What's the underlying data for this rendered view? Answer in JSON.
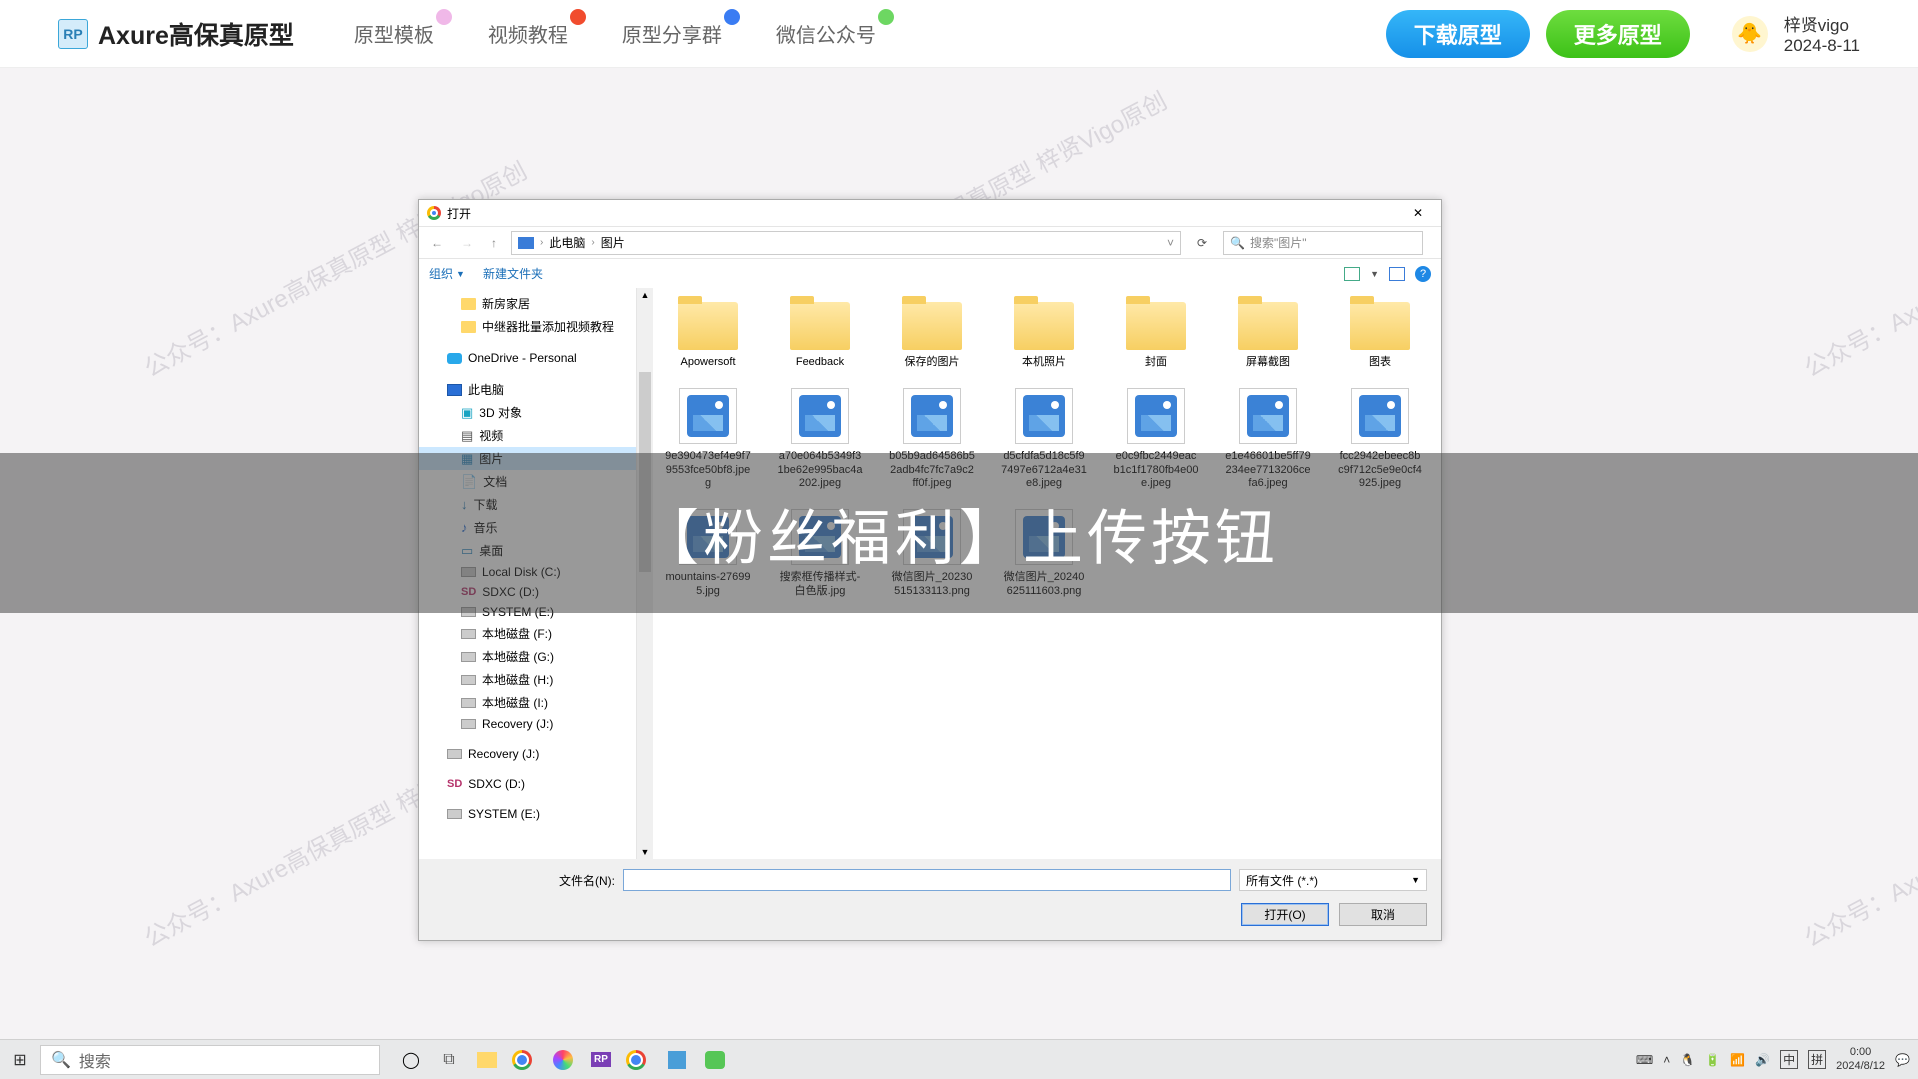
{
  "header": {
    "logo_badge": "RP",
    "logo_text": "Axure高保真原型",
    "nav": [
      "原型模板",
      "视频教程",
      "原型分享群",
      "微信公众号"
    ],
    "btn_download": "下载原型",
    "btn_more": "更多原型",
    "username": "梓贤vigo",
    "user_date": "2024-8-11"
  },
  "watermark": "公众号：Axure高保真原型 梓贤Vigo原创",
  "overlay_text": "【粉丝福利】上传按钮",
  "dialog": {
    "title": "打开",
    "breadcrumb": [
      "此电脑",
      "图片"
    ],
    "search_placeholder": "搜索\"图片\"",
    "toolbar": {
      "organize": "组织",
      "newfolder": "新建文件夹"
    },
    "tree": [
      {
        "label": "新房家居",
        "cls": "ti-folder",
        "lvl": 2
      },
      {
        "label": "中继器批量添加视频教程",
        "cls": "ti-folder",
        "lvl": 2
      },
      {
        "label": "OneDrive - Personal",
        "cls": "ti-onedrive",
        "lvl": 1,
        "spaced": true
      },
      {
        "label": "此电脑",
        "cls": "ti-pc",
        "lvl": 1,
        "spaced": true
      },
      {
        "label": "3D 对象",
        "cls": "ti-3d",
        "glyph": "▣",
        "lvl": 2
      },
      {
        "label": "视频",
        "cls": "ti-vid",
        "glyph": "▤",
        "lvl": 2
      },
      {
        "label": "图片",
        "cls": "ti-img",
        "glyph": "▦",
        "lvl": 2,
        "selected": true
      },
      {
        "label": "文档",
        "cls": "ti-doc",
        "glyph": "📄",
        "lvl": 2
      },
      {
        "label": "下载",
        "cls": "ti-down",
        "glyph": "↓",
        "lvl": 2
      },
      {
        "label": "音乐",
        "cls": "ti-music",
        "glyph": "♪",
        "lvl": 2
      },
      {
        "label": "桌面",
        "cls": "ti-desk",
        "glyph": "▭",
        "lvl": 2
      },
      {
        "label": "Local Disk (C:)",
        "cls": "ti-disk",
        "lvl": 2
      },
      {
        "label": "SDXC (D:)",
        "cls": "ti-sd",
        "glyph": "SD",
        "lvl": 2
      },
      {
        "label": "SYSTEM (E:)",
        "cls": "ti-disk",
        "lvl": 2
      },
      {
        "label": "本地磁盘 (F:)",
        "cls": "ti-disk",
        "lvl": 2
      },
      {
        "label": "本地磁盘 (G:)",
        "cls": "ti-disk",
        "lvl": 2
      },
      {
        "label": "本地磁盘 (H:)",
        "cls": "ti-disk",
        "lvl": 2
      },
      {
        "label": "本地磁盘 (I:)",
        "cls": "ti-disk",
        "lvl": 2
      },
      {
        "label": "Recovery (J:)",
        "cls": "ti-disk",
        "lvl": 2
      },
      {
        "label": "Recovery (J:)",
        "cls": "ti-disk",
        "lvl": 1,
        "spaced": true
      },
      {
        "label": "SDXC (D:)",
        "cls": "ti-sd",
        "glyph": "SD",
        "lvl": 1,
        "spaced": true
      },
      {
        "label": "SYSTEM (E:)",
        "cls": "ti-disk",
        "lvl": 1,
        "spaced": true
      }
    ],
    "folders": [
      "Apowersoft",
      "Feedback",
      "保存的图片",
      "本机照片",
      "封面",
      "屏幕截图",
      "图表"
    ],
    "images_row1": [
      "9e390473ef4e9f79553fce50bf8.jpeg",
      "a70e064b5349f31be62e995bac4a202.jpeg",
      "b05b9ad64586b52adb4fc7fc7a9c2ff0f.jpeg",
      "d5cfdfa5d18c5f97497e6712a4e31e8.jpeg",
      "e0c9fbc2449eacb1c1f1780fb4e00e.jpeg",
      "e1e46601be5ff79234ee7713206cefa6.jpeg"
    ],
    "images_row2": [
      "fcc2942ebeec8bc9f712c5e9e0cf4925.jpeg",
      "mountains-276995.jpg",
      "搜索框传播样式-白色版.jpg",
      "微信图片_20230515133113.png",
      "微信图片_20240625111603.png"
    ],
    "footer": {
      "filename_label": "文件名(N):",
      "filter": "所有文件 (*.*)",
      "open": "打开(O)",
      "cancel": "取消"
    }
  },
  "taskbar": {
    "search": "搜索",
    "ime1": "中",
    "ime2": "拼",
    "time": "0:00",
    "date": "2024/8/12"
  }
}
